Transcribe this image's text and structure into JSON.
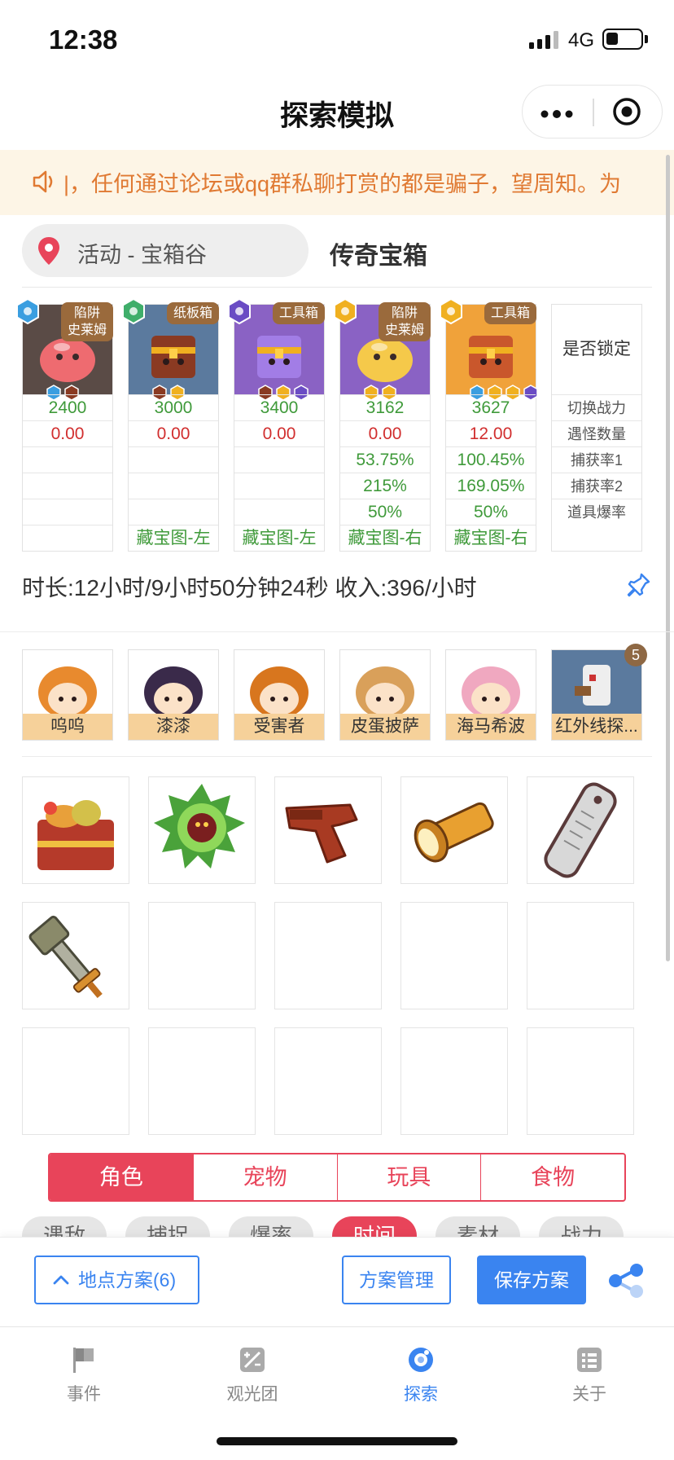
{
  "status_bar": {
    "time": "12:38",
    "network": "4G"
  },
  "header": {
    "title": "探索模拟"
  },
  "notice": {
    "text": "|，任何通过论坛或qq群私聊打赏的都是骗子，望周知。为"
  },
  "location": {
    "text": "活动 - 宝箱谷"
  },
  "chest": {
    "title": "传奇宝箱"
  },
  "enemies": [
    {
      "tag": "陷阱\n史莱姆",
      "power": "2400",
      "encounter": "0.00",
      "capture1": "",
      "capture2": "",
      "drop": "",
      "map": "",
      "portrait_color": "#5a4b46"
    },
    {
      "tag": "纸板箱",
      "power": "3000",
      "encounter": "0.00",
      "capture1": "",
      "capture2": "",
      "drop": "",
      "map": "藏宝图-左",
      "portrait_color": "#5b7a9e"
    },
    {
      "tag": "工具箱",
      "power": "3400",
      "encounter": "0.00",
      "capture1": "",
      "capture2": "",
      "drop": "",
      "map": "藏宝图-左",
      "portrait_color": "#8a62c4"
    },
    {
      "tag": "陷阱\n史莱姆",
      "power": "3162",
      "encounter": "0.00",
      "capture1": "53.75%",
      "capture2": "215%",
      "drop": "50%",
      "map": "藏宝图-右",
      "portrait_color": "#8a62c4"
    },
    {
      "tag": "工具箱",
      "power": "3627",
      "encounter": "12.00",
      "capture1": "100.45%",
      "capture2": "169.05%",
      "drop": "50%",
      "map": "藏宝图-右",
      "portrait_color": "#f0a23a"
    }
  ],
  "row_labels": {
    "lock": "是否锁定",
    "power": "切换战力",
    "encounter": "遇怪数量",
    "capture1": "捕获率1",
    "capture2": "捕获率2",
    "drop": "道具爆率"
  },
  "summary": {
    "text": "时长:12小时/9小时50分钟24秒 收入:396/小时"
  },
  "characters": [
    {
      "name": "呜呜"
    },
    {
      "name": "漆漆"
    },
    {
      "name": "受害者"
    },
    {
      "name": "皮蛋披萨"
    },
    {
      "name": "海马希波"
    },
    {
      "name": "红外线探..."
    }
  ],
  "character_badge": "5",
  "items": [
    "lunchbox-icon",
    "green-sun-flower-icon",
    "flare-gun-icon",
    "flashlight-icon",
    "gauge-tag-icon",
    "sword-icon",
    "",
    "",
    "",
    "",
    "",
    "",
    "",
    "",
    ""
  ],
  "category_tabs": [
    "角色",
    "宠物",
    "玩具",
    "食物"
  ],
  "category_active": 0,
  "sort_chips": [
    "遇敌",
    "捕捉",
    "爆率",
    "时间",
    "素材",
    "战力"
  ],
  "sort_active": 3,
  "actions": {
    "plan": "地点方案(6)",
    "manage": "方案管理",
    "save": "保存方案"
  },
  "tabbar": [
    {
      "label": "事件",
      "icon": "flag-icon"
    },
    {
      "label": "观光团",
      "icon": "tour-icon"
    },
    {
      "label": "探索",
      "icon": "explore-icon"
    },
    {
      "label": "关于",
      "icon": "list-icon"
    }
  ],
  "tabbar_active": 2,
  "colors": {
    "accent_red": "#e8445a",
    "accent_blue": "#3a84f0",
    "notice_text": "#e07a33",
    "power_green": "#3f9a3a",
    "value_red": "#d12e2e",
    "name_bg": "#f6d19a"
  }
}
